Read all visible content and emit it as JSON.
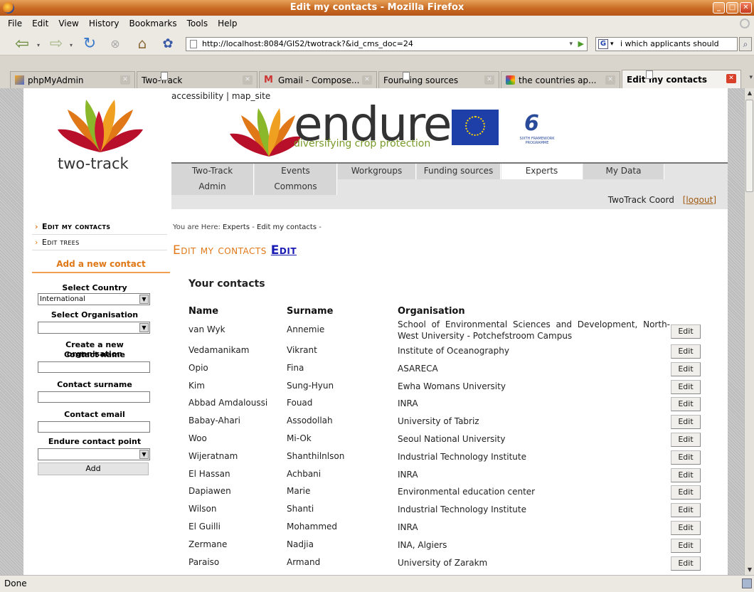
{
  "window": {
    "title": "Edit my contacts - Mozilla Firefox"
  },
  "menubar": [
    "File",
    "Edit",
    "View",
    "History",
    "Bookmarks",
    "Tools",
    "Help"
  ],
  "navbar": {
    "url": "http://localhost:8084/GIS2/twotrack?&id_cms_doc=24",
    "search_value": "i which applicants should"
  },
  "tabs": [
    {
      "label": "phpMyAdmin",
      "icon": "phpmyadmin-icon"
    },
    {
      "label": "Two-Track",
      "icon": "page-icon"
    },
    {
      "label": "Gmail - Compose...",
      "icon": "gmail-icon"
    },
    {
      "label": "Founding sources",
      "icon": "page-icon"
    },
    {
      "label": "the countries ap...",
      "icon": "globe-icon"
    },
    {
      "label": "Edit my contacts",
      "icon": "page-icon",
      "active": true
    }
  ],
  "status": "Done",
  "site": {
    "top_links": [
      "accessibility",
      "map_site"
    ],
    "logo_text": "two-track",
    "banner_word": "endure",
    "banner_sub": "diversifying crop protection",
    "fp6_text": "SIXTH FRAMEWORK PROGRAMME",
    "menu": {
      "row1": [
        "Two-Track",
        "Events",
        "Workgroups",
        "Funding sources",
        "Experts",
        "My Data"
      ],
      "row2": [
        "Admin",
        "Commons"
      ],
      "active": "Experts"
    },
    "user": "TwoTrack Coord",
    "logout": "[logout]"
  },
  "sidebar": {
    "items": [
      "Edit my contacts",
      "Edit trees"
    ],
    "add_heading": "Add a new contact",
    "form": {
      "country_label": "Select Country",
      "country_value": "International",
      "org_label": "Select Organisation",
      "org_value": "",
      "create_org_label": "Create a new organisation",
      "name_label": "Contact name",
      "surname_label": "Contact surname",
      "email_label": "Contact email",
      "endure_label": "Endure contact point",
      "endure_value": "",
      "add_button": "Add"
    }
  },
  "main": {
    "breadcrumb_prefix": "You are Here:",
    "breadcrumb": [
      "Experts",
      "Edit my contacts"
    ],
    "title": "Edit my contacts",
    "title_link": "Edit",
    "contacts_heading": "Your contacts",
    "columns": [
      "Name",
      "Surname",
      "Organisation"
    ],
    "edit_label": "Edit",
    "rows": [
      {
        "name": "van Wyk",
        "surname": "Annemie",
        "org": "School of Environmental Sciences and Development, North-West University - Potchefstroom Campus"
      },
      {
        "name": "Vedamanikam",
        "surname": "Vikrant",
        "org": "Institute of Oceanography"
      },
      {
        "name": "Opio",
        "surname": "Fina",
        "org": "ASARECA"
      },
      {
        "name": "Kim",
        "surname": "Sung-Hyun",
        "org": "Ewha Womans University"
      },
      {
        "name": "Abbad Amdaloussi",
        "surname": "Fouad",
        "org": "INRA"
      },
      {
        "name": "Babay-Ahari",
        "surname": "Assodollah",
        "org": "University of Tabriz"
      },
      {
        "name": "Woo",
        "surname": "Mi-Ok",
        "org": "Seoul National University"
      },
      {
        "name": "Wijeratnam",
        "surname": "Shanthilnlson",
        "org": "Industrial Technology Institute"
      },
      {
        "name": "El Hassan",
        "surname": "Achbani",
        "org": "INRA"
      },
      {
        "name": "Dapiawen",
        "surname": "Marie",
        "org": "Environmental education center"
      },
      {
        "name": "Wilson",
        "surname": "Shanti",
        "org": "Industrial Technology Institute"
      },
      {
        "name": "El Guilli",
        "surname": "Mohammed",
        "org": "INRA"
      },
      {
        "name": "Zermane",
        "surname": "Nadjia",
        "org": "INA, Algiers"
      },
      {
        "name": "Paraiso",
        "surname": "Armand",
        "org": "University of Zarakm"
      }
    ]
  },
  "colors": {
    "titlebar": "#c86a22",
    "accent_orange": "#e07818",
    "link_blue": "#1a1ab4",
    "banner_green": "#7a9a2a"
  }
}
